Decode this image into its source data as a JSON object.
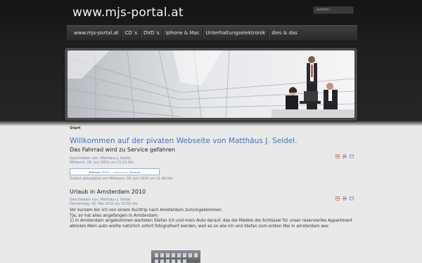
{
  "site": {
    "title": "www.mjs-portal.at"
  },
  "search": {
    "placeholder": "suchen..."
  },
  "nav": {
    "items": [
      "www.mjs-portal.at",
      "CD´s",
      "DVD´s",
      "Iphone & Mac",
      "Unterhaltungselektronik",
      "dies & das"
    ]
  },
  "breadcrumb": "Start",
  "welcome": "Willkommen auf der pivaten Webseite von Matthäus J. Seidel.",
  "articles": [
    {
      "title": "Das Fahrrad wird zu Service gefahren",
      "author": "Geschrieben von: Matthäus J. Seidel",
      "date": "Mittwoch, 09. Juni 2010 um 21:22 Uhr",
      "rating": {
        "label": "Riskssix",
        "count": "53459",
        "powered": "- powered by",
        "brand": "Blomap"
      },
      "updated": "Zuletzt aktualisiert am Mittwoch, 09. Juni 2010 um 21:49 Uhr"
    },
    {
      "title": "Urlaub in Amsterdam 2010",
      "author": "Geschrieben von: Matthäus J. Seidel",
      "date": "Donnerstag, 06. Mai 2010 um 19:56 Uhr",
      "paragraphs": [
        "Vor kurzem bin ich von einem Kurztrip nach Amsterdam zurückgekommen.",
        "Tja, so hat alles angefangen in Amsterdam:",
        "1) In Amsterdam angekommen warteten Stefan ich und mein Auto darauf, das die Mädels die Schlüssel für unser reserviertes Appartment abholen.Mein auto wollte natürlich sofort fotografoert werden, weil es so wie ich und Stefan zum ersten Mal in amsterdam war."
      ]
    }
  ],
  "icons": {
    "pdf": "pdf-icon",
    "print": "print-icon",
    "email": "email-icon"
  },
  "colors": {
    "link": "#3a73c6",
    "header": "#1e1e1e",
    "page": "#e9e9e9"
  }
}
